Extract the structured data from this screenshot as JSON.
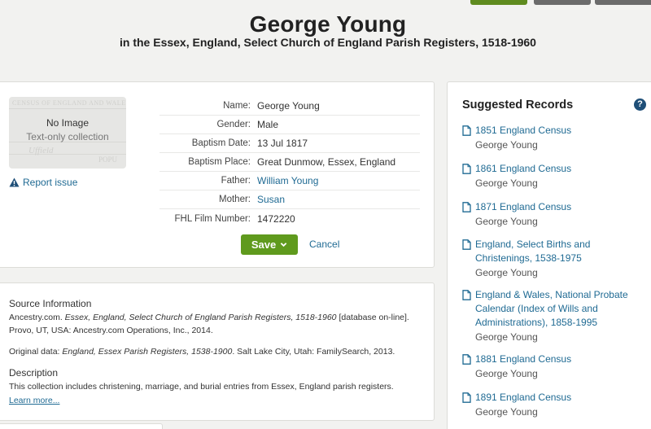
{
  "header": {
    "title": "George Young",
    "subtitle": "in the Essex, England, Select Church of England Parish Registers, 1518-1960"
  },
  "image": {
    "no_image": "No Image",
    "text_only": "Text-only collection",
    "bg_text_1": "CENSUS OF ENGLAND AND WALES",
    "bg_text_2": "Uffield",
    "bg_text_3": "POPU"
  },
  "report_issue": "Report issue",
  "fields": [
    {
      "label": "Name:",
      "value": "George Young",
      "link": false
    },
    {
      "label": "Gender:",
      "value": "Male",
      "link": false
    },
    {
      "label": "Baptism Date:",
      "value": "13 Jul 1817",
      "link": false
    },
    {
      "label": "Baptism Place:",
      "value": "Great Dunmow, Essex, England",
      "link": false
    },
    {
      "label": "Father:",
      "value": "William Young",
      "link": true
    },
    {
      "label": "Mother:",
      "value": "Susan",
      "link": true
    },
    {
      "label": "FHL Film Number:",
      "value": "1472220",
      "link": false
    }
  ],
  "actions": {
    "save": "Save",
    "cancel": "Cancel"
  },
  "source": {
    "heading": "Source Information",
    "citation_prefix": "Ancestry.com. ",
    "citation_title": "Essex, England, Select Church of England Parish Registers, 1518-1960",
    "citation_suffix": " [database on-line].",
    "citation_line2": "Provo, UT, USA: Ancestry.com Operations, Inc., 2014.",
    "original_prefix": "Original data: ",
    "original_title": "England, Essex Parish Registers, 1538-1900",
    "original_suffix": ". Salt Lake City, Utah: FamilySearch, 2013.",
    "description_heading": "Description",
    "description": "This collection includes christening, marriage, and burial entries from Essex, England parish registers.",
    "learn_more": "Learn more..."
  },
  "suggested": {
    "title": "Suggested Records",
    "help": "?",
    "items": [
      {
        "title": "1851 England Census",
        "person": "George Young"
      },
      {
        "title": "1861 England Census",
        "person": "George Young"
      },
      {
        "title": "1871 England Census",
        "person": "George Young"
      },
      {
        "title": "England, Select Births and Christenings, 1538-1975",
        "person": "George Young"
      },
      {
        "title": "England & Wales, National Probate Calendar (Index of Wills and Administrations), 1858-1995",
        "person": "George Young"
      },
      {
        "title": "1881 England Census",
        "person": "George Young"
      },
      {
        "title": "1891 England Census",
        "person": "George Young"
      }
    ]
  },
  "colors": {
    "accent_green": "#5f9a1d",
    "link_blue": "#1f6a93",
    "help_blue": "#1f4f78"
  }
}
